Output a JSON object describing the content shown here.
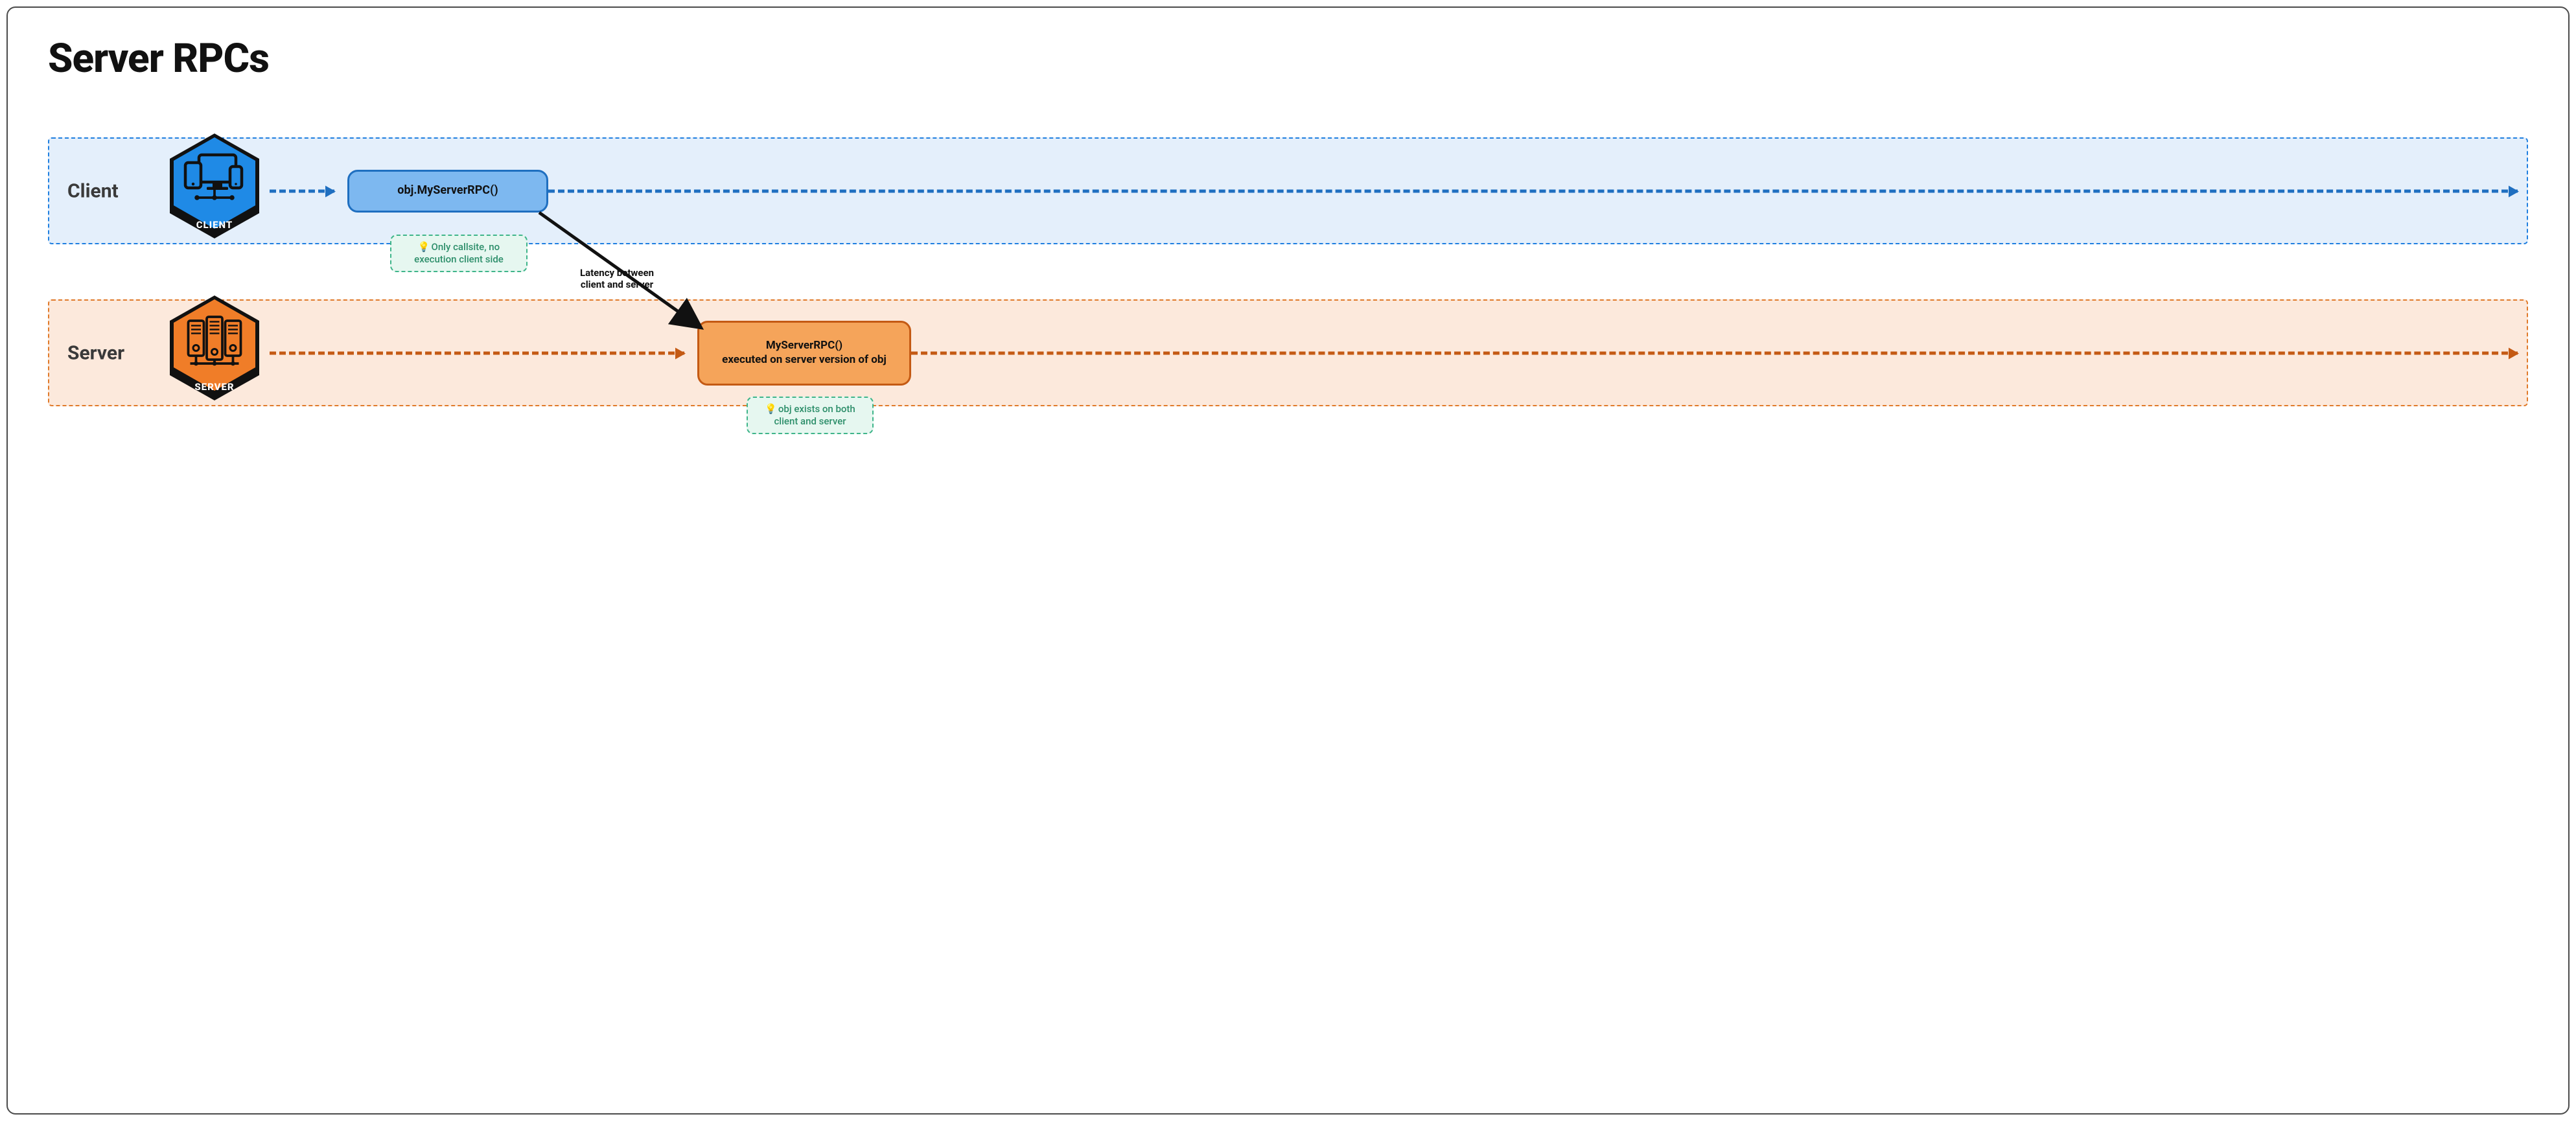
{
  "title": "Server RPCs",
  "lanes": {
    "client": {
      "label": "Client",
      "badge": "CLIENT"
    },
    "server": {
      "label": "Server",
      "badge": "SERVER"
    }
  },
  "nodes": {
    "client_call": "obj.MyServerRPC()",
    "server_exec_line1": "MyServerRPC()",
    "server_exec_line2": "executed on server version of obj"
  },
  "hints": {
    "client": "Only callsite, no execution client side",
    "server": "obj exists on both client and server"
  },
  "latency_label_line1": "Latency between",
  "latency_label_line2": "client and server",
  "colors": {
    "client_accent": "#1f7fe0",
    "client_dark": "#1f6fc0",
    "server_accent": "#e07a2a",
    "server_dark": "#c45a14",
    "hint_border": "#3fb58a",
    "hint_bg": "#e6f7f0"
  }
}
